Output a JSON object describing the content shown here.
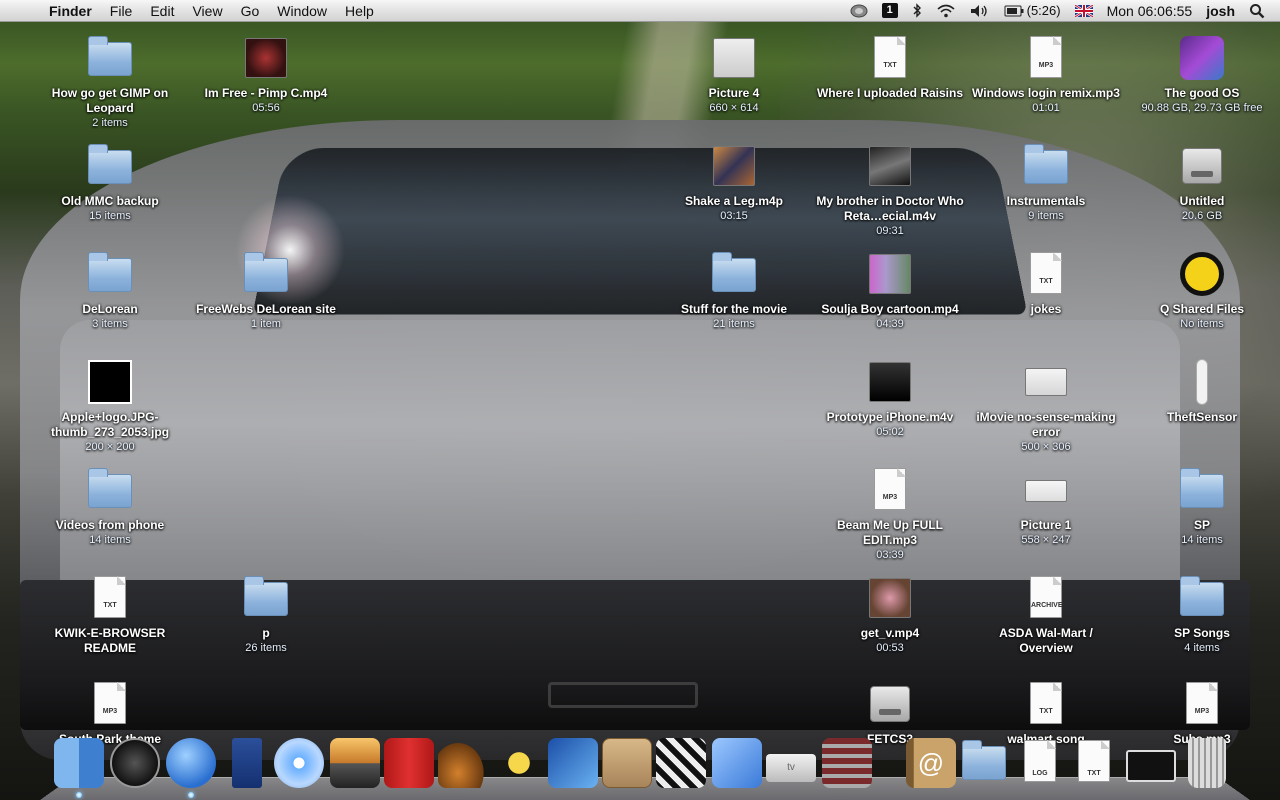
{
  "menubar": {
    "apple_glyph": "",
    "app_name": "Finder",
    "menus": [
      "File",
      "Edit",
      "View",
      "Go",
      "Window",
      "Help"
    ],
    "space_number": "1",
    "battery_text": "(5:26)",
    "clock": "Mon 06:06:55",
    "user": "josh"
  },
  "desktop_icons": [
    {
      "name": "How go get GIMP on Leopard",
      "info": "2 items",
      "kind": "folder"
    },
    {
      "name": "Im Free - Pimp C.mp4",
      "info": "05:56",
      "kind": "video"
    },
    {
      "name": "Picture 4",
      "info": "660 × 614",
      "kind": "image"
    },
    {
      "name": "Where I uploaded Raisins",
      "info": "",
      "kind": "txt"
    },
    {
      "name": "Windows login remix.mp3",
      "info": "01:01",
      "kind": "mp3"
    },
    {
      "name": "The good OS",
      "info": "90.88 GB, 29.73 GB free",
      "kind": "disk"
    },
    {
      "name": "Old MMC backup",
      "info": "15 items",
      "kind": "folder"
    },
    {
      "name": "Shake a Leg.m4p",
      "info": "03:15",
      "kind": "video"
    },
    {
      "name": "My brother in Doctor Who Reta…ecial.m4v",
      "info": "09:31",
      "kind": "video"
    },
    {
      "name": "Instrumentals",
      "info": "9 items",
      "kind": "folder"
    },
    {
      "name": "Untitled",
      "info": "20.6 GB",
      "kind": "disk"
    },
    {
      "name": "DeLorean",
      "info": "3 items",
      "kind": "folder"
    },
    {
      "name": "FreeWebs DeLorean site",
      "info": "1 item",
      "kind": "folder"
    },
    {
      "name": "Stuff for the movie",
      "info": "21 items",
      "kind": "folder"
    },
    {
      "name": "Soulja Boy cartoon.mp4",
      "info": "04:39",
      "kind": "video"
    },
    {
      "name": "jokes",
      "info": "",
      "kind": "txt"
    },
    {
      "name": "Q Shared Files",
      "info": "No items",
      "kind": "q"
    },
    {
      "name": "Apple+logo.JPG-thumb_273_2053.jpg",
      "info": "200 × 200",
      "kind": "apple"
    },
    {
      "name": "Prototype iPhone.m4v",
      "info": "05:02",
      "kind": "video"
    },
    {
      "name": "iMovie no-sense-making error",
      "info": "500 × 306",
      "kind": "image"
    },
    {
      "name": "TheftSensor",
      "info": "",
      "kind": "remote"
    },
    {
      "name": "Videos from phone",
      "info": "14 items",
      "kind": "folder"
    },
    {
      "name": "Beam Me Up FULL EDIT.mp3",
      "info": "03:39",
      "kind": "mp3"
    },
    {
      "name": "Picture 1",
      "info": "558 × 247",
      "kind": "image"
    },
    {
      "name": "SP",
      "info": "14 items",
      "kind": "folder"
    },
    {
      "name": "KWIK-E-BROWSER README",
      "info": "",
      "kind": "txt"
    },
    {
      "name": "p",
      "info": "26 items",
      "kind": "folder"
    },
    {
      "name": "get_v.mp4",
      "info": "00:53",
      "kind": "video"
    },
    {
      "name": "ASDA Wal-Mart / Overview",
      "info": "",
      "kind": "archive"
    },
    {
      "name": "SP Songs",
      "info": "4 items",
      "kind": "folder"
    },
    {
      "name": "South Park theme",
      "info": "",
      "kind": "mp3"
    },
    {
      "name": "FETCS3",
      "info": "",
      "kind": "disk"
    },
    {
      "name": "walmart song",
      "info": "",
      "kind": "txt"
    },
    {
      "name": "Subs.mp3",
      "info": "",
      "kind": "mp3"
    }
  ],
  "dock_items": [
    "Finder",
    "Dashboard",
    "iChat",
    "TARDIS",
    "iTunes",
    "iPhoto",
    "Front Row",
    "Photo Booth",
    "GarageBand",
    "iMovie",
    "Final Cut",
    "Switch",
    "Clapper",
    "Xcode",
    "Apple TV",
    "Network",
    "Address Book",
    "Documents",
    "Log",
    "Text",
    "Terminal",
    "Trash"
  ],
  "dock_labels": {
    "log": "LOG",
    "txt": "TXT",
    "tv": "tv"
  },
  "icon_tags": {
    "txt": "TXT",
    "mp3": "MP3",
    "archive": "ARCHIVE",
    "apple": ""
  }
}
